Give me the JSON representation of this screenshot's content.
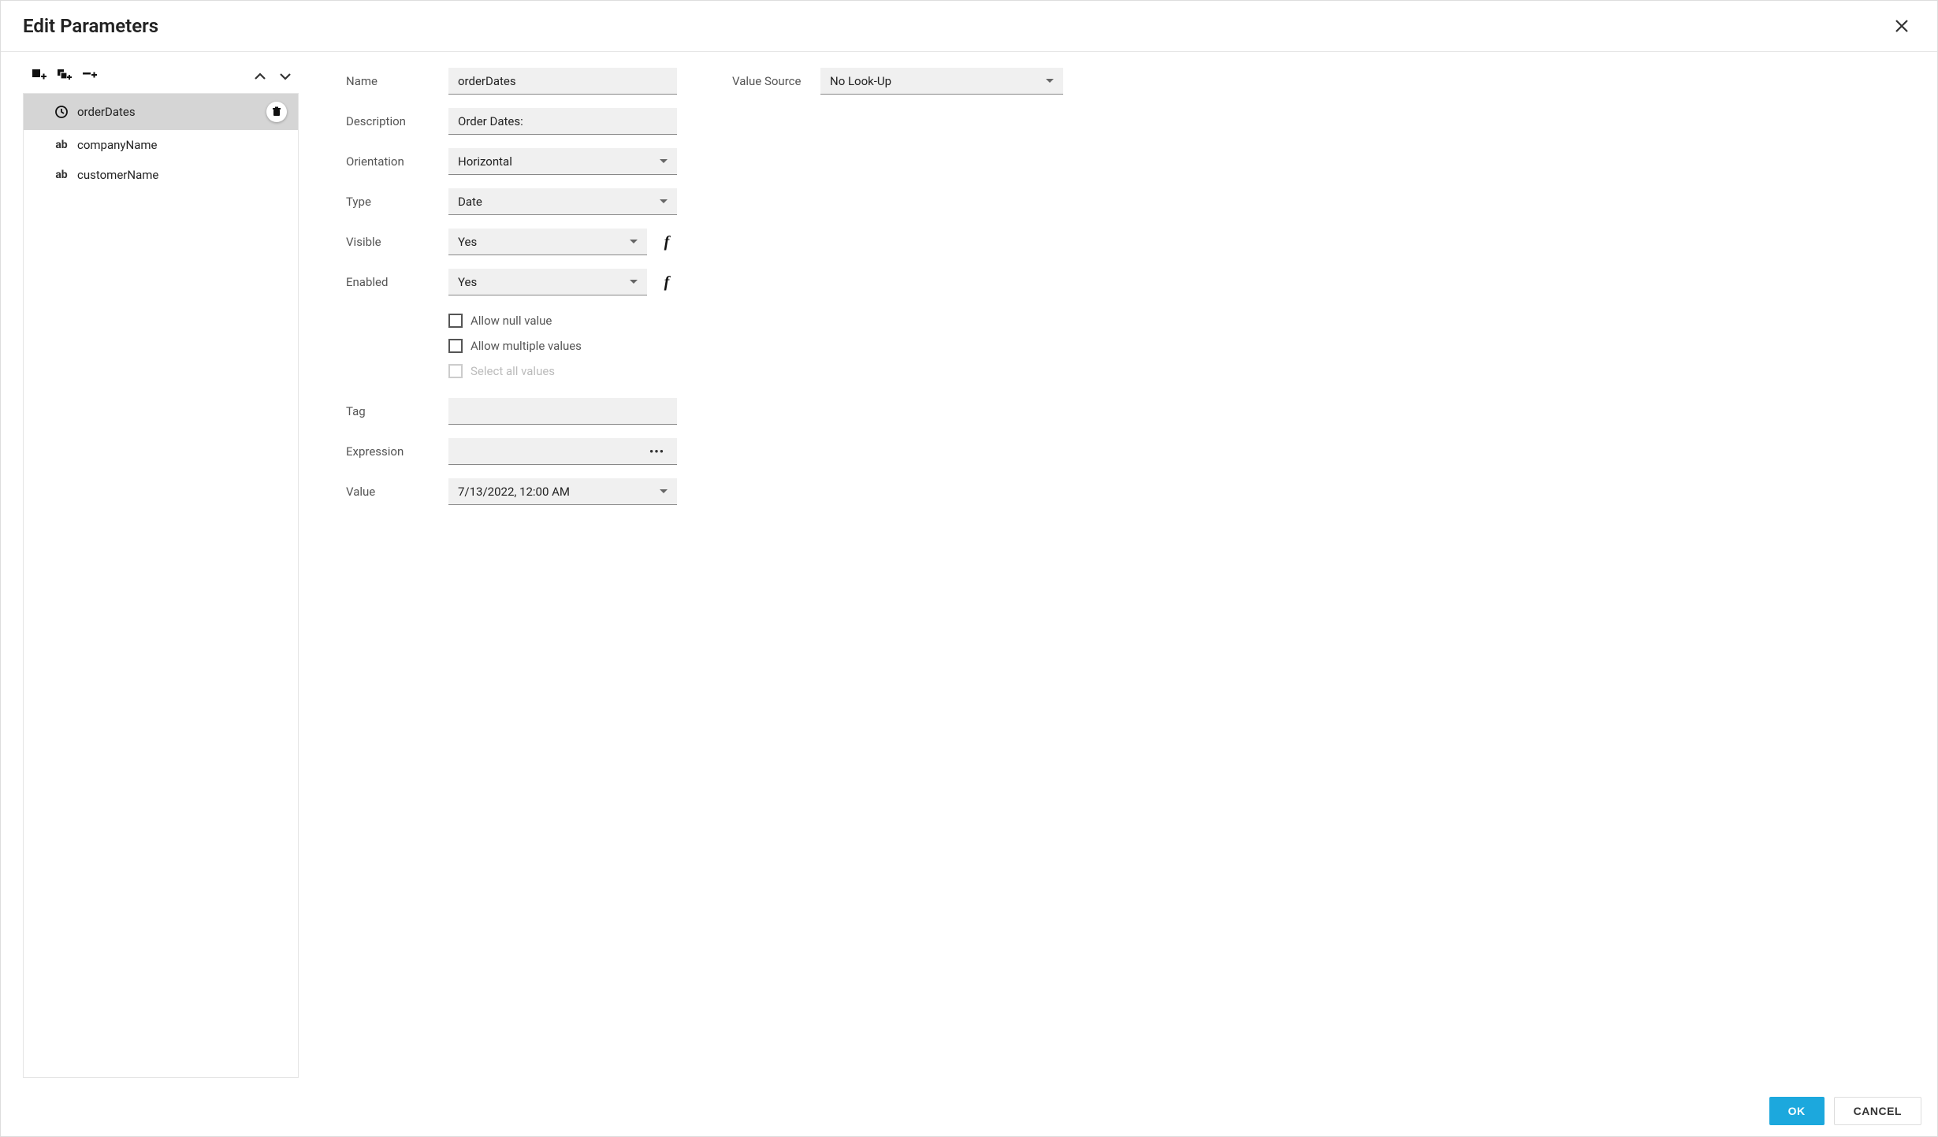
{
  "dialog": {
    "title": "Edit Parameters",
    "ok": "OK",
    "cancel": "CANCEL"
  },
  "parameters": {
    "items": [
      {
        "label": "orderDates",
        "iconType": "clock",
        "selected": true
      },
      {
        "label": "companyName",
        "iconType": "ab",
        "selected": false
      },
      {
        "label": "customerName",
        "iconType": "ab",
        "selected": false
      }
    ]
  },
  "labels": {
    "name": "Name",
    "description": "Description",
    "orientation": "Orientation",
    "type": "Type",
    "visible": "Visible",
    "enabled": "Enabled",
    "allow_null": "Allow null value",
    "allow_multiple": "Allow multiple values",
    "select_all": "Select all values",
    "tag": "Tag",
    "expression": "Expression",
    "value": "Value",
    "value_source": "Value Source"
  },
  "form": {
    "name": "orderDates",
    "description": "Order Dates:",
    "orientation": "Horizontal",
    "type": "Date",
    "visible": "Yes",
    "enabled": "Yes",
    "tag": "",
    "expression": "",
    "value": "7/13/2022, 12:00 AM",
    "value_source": "No Look-Up"
  }
}
